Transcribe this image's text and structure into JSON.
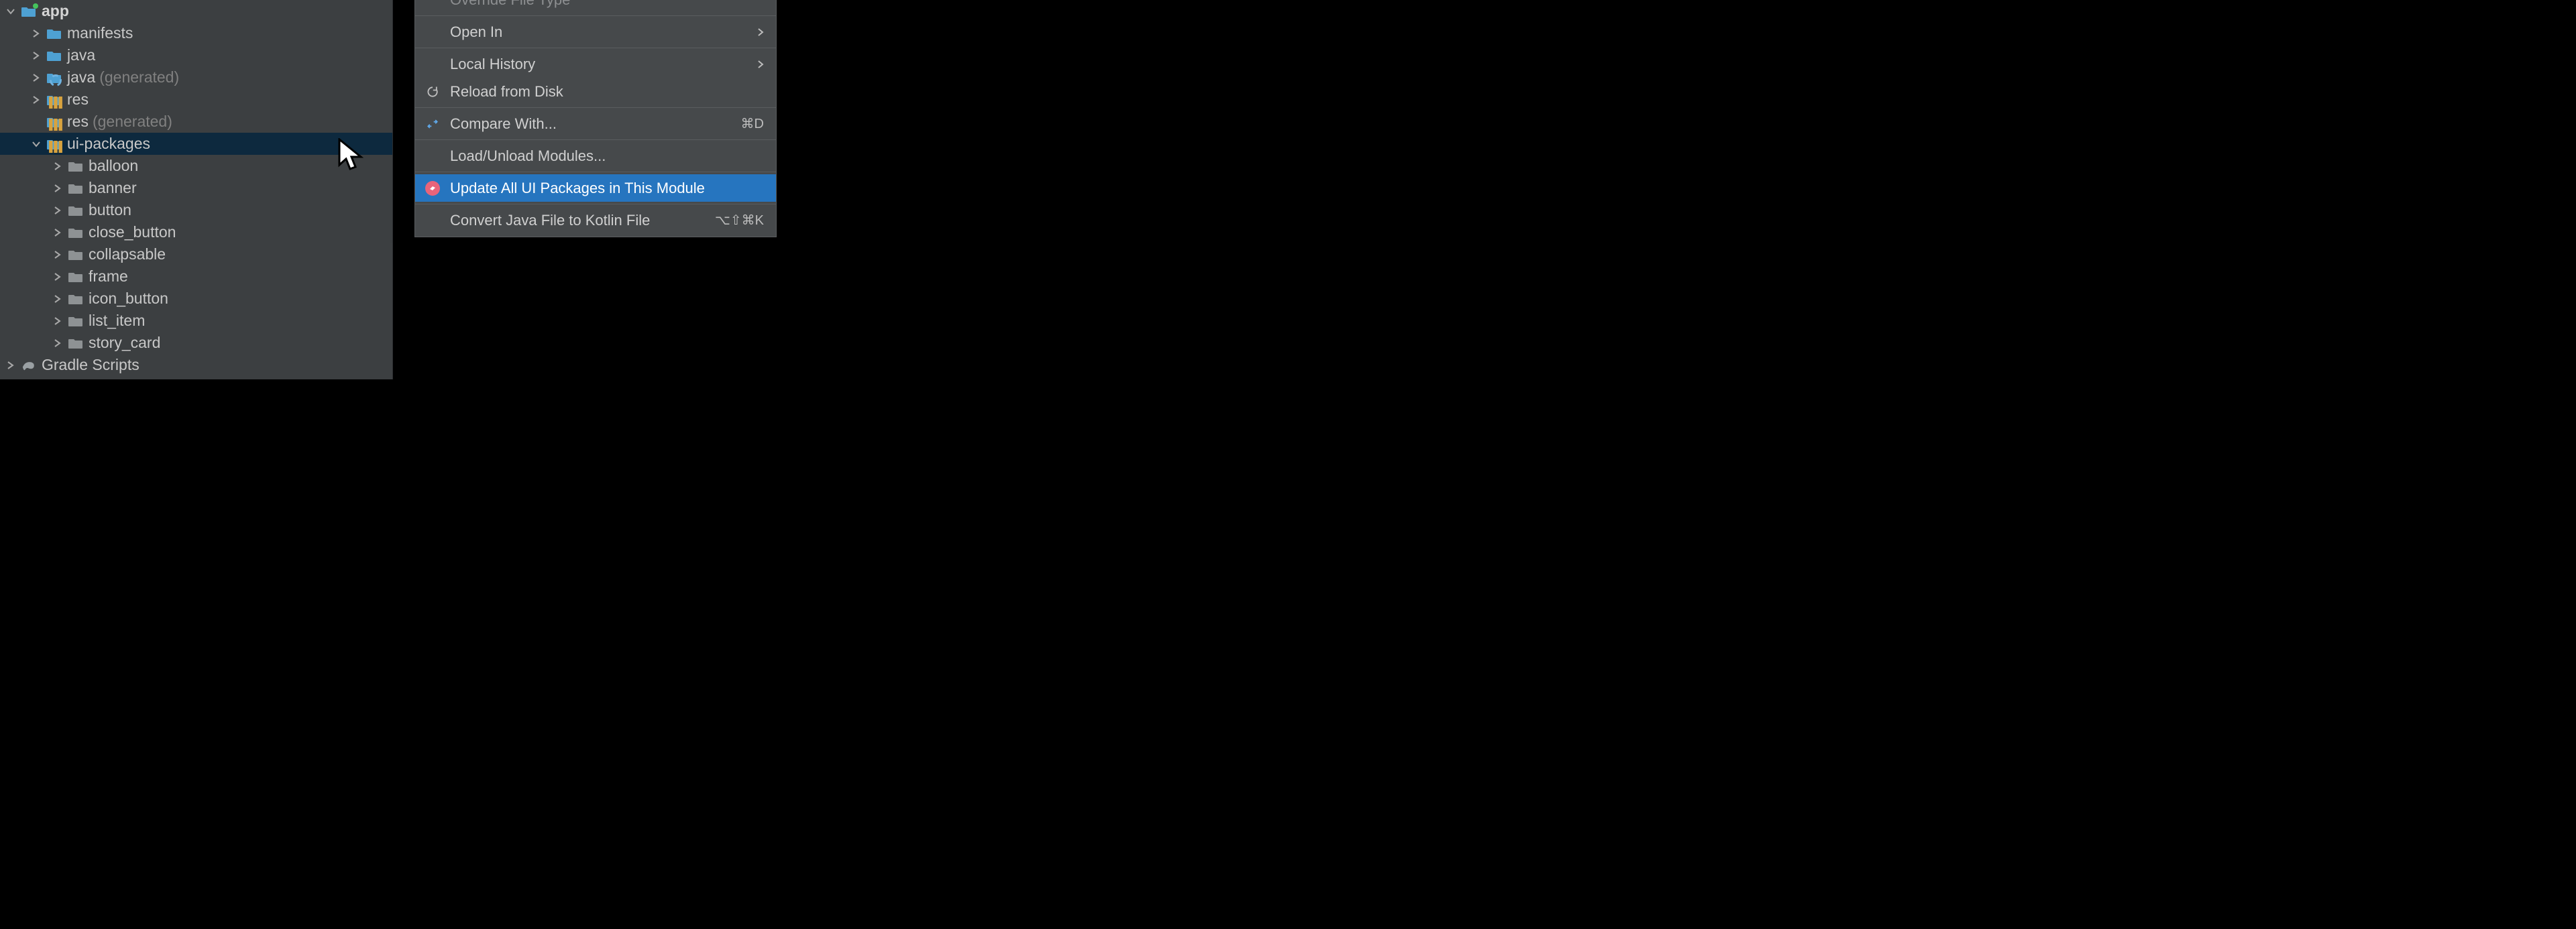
{
  "tree": {
    "app": "app",
    "manifests": "manifests",
    "java": "java",
    "java_gen": "java",
    "java_gen_suffix": "(generated)",
    "res": "res",
    "res_gen": "res",
    "res_gen_suffix": "(generated)",
    "ui_packages": "ui-packages",
    "gradle_scripts": "Gradle Scripts",
    "pkgs": {
      "balloon": "balloon",
      "banner": "banner",
      "button": "button",
      "close_button": "close_button",
      "collapsable": "collapsable",
      "frame": "frame",
      "icon_button": "icon_button",
      "list_item": "list_item",
      "story_card": "story_card"
    }
  },
  "menu": {
    "override_file_type": "Override File Type",
    "open_in": "Open In",
    "local_history": "Local History",
    "reload_from_disk": "Reload from Disk",
    "compare_with": "Compare With...",
    "compare_with_sc": "⌘D",
    "load_unload": "Load/Unload Modules...",
    "update_ui": "Update All UI Packages in This Module",
    "convert_kotlin": "Convert Java File to Kotlin File",
    "convert_kotlin_sc": "⌥⇧⌘K"
  }
}
